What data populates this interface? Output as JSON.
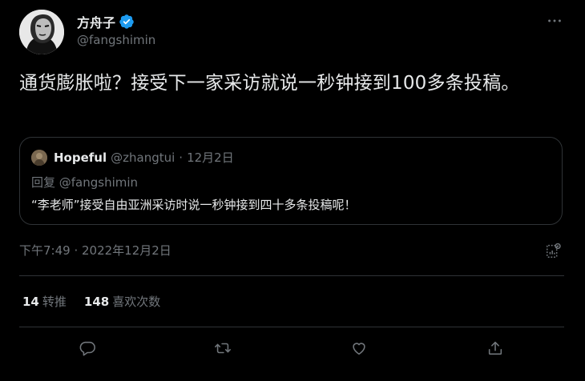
{
  "author": {
    "name": "方舟子",
    "handle": "@fangshimin"
  },
  "tweet": {
    "text": "通货膨胀啦？接受下一家采访就说一秒钟接到100多条投稿。",
    "timestamp": "下午7:49 · 2022年12月2日"
  },
  "quote": {
    "name": "Hopeful",
    "handle": "@zhangtui",
    "separator": "·",
    "date": "12月2日",
    "reply_to": "回复 @fangshimin",
    "text": "“李老师”接受自由亚洲采访时说一秒钟接到四十多条投稿呢！"
  },
  "stats": {
    "retweets_count": "14",
    "retweets_label": "转推",
    "likes_count": "148",
    "likes_label": "喜欢次数"
  },
  "icons": {
    "verified": "verified-badge-icon",
    "more": "more-icon",
    "analytics": "analytics-icon",
    "reply": "reply-icon",
    "retweet": "retweet-icon",
    "like": "like-icon",
    "share": "share-icon"
  },
  "colors": {
    "background": "#000000",
    "text": "#e7e9ea",
    "muted": "#71767b",
    "border": "#2f3336",
    "verified": "#1d9bf0"
  }
}
